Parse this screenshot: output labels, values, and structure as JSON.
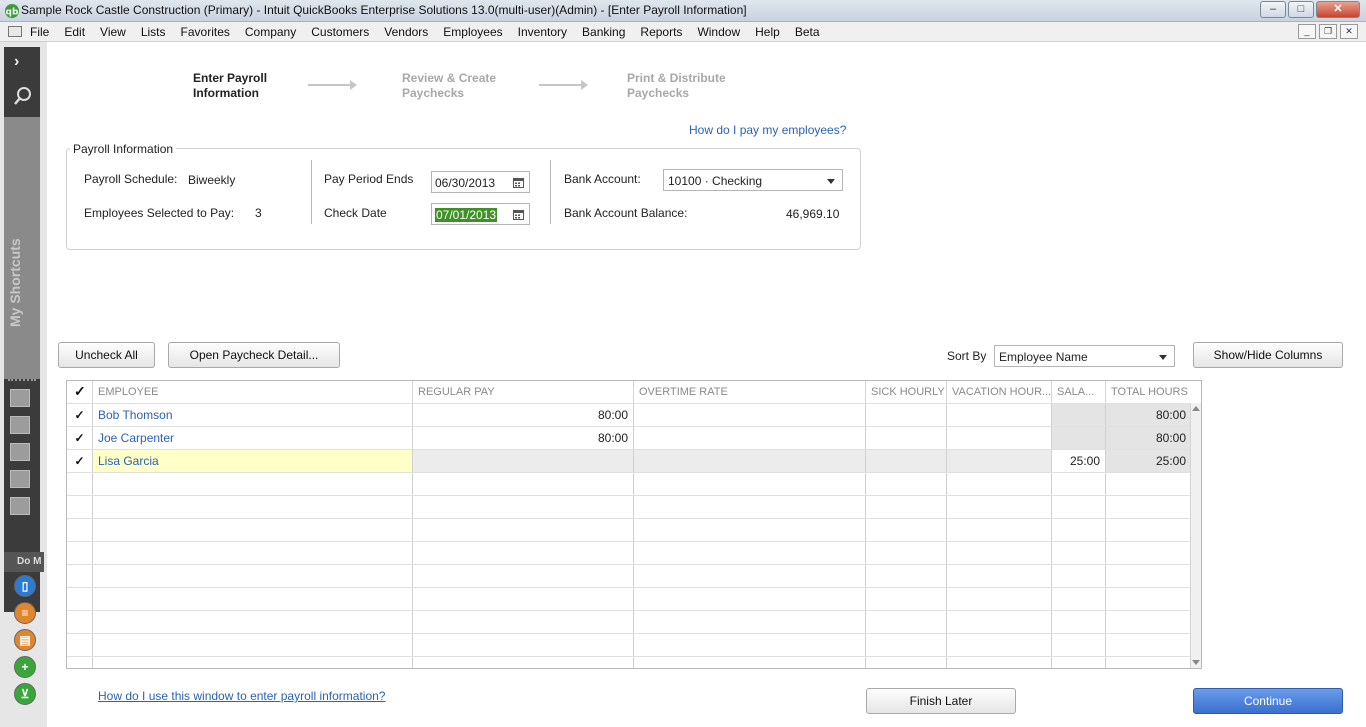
{
  "window": {
    "title": "Sample Rock Castle Construction (Primary)  - Intuit QuickBooks Enterprise Solutions 13.0(multi-user)(Admin) - [Enter Payroll Information]"
  },
  "menu": [
    "File",
    "Edit",
    "View",
    "Lists",
    "Favorites",
    "Company",
    "Customers",
    "Vendors",
    "Employees",
    "Inventory",
    "Banking",
    "Reports",
    "Window",
    "Help",
    "Beta"
  ],
  "sidebar": {
    "shortcuts_label": "My Shortcuts",
    "do_more_label": "Do M"
  },
  "steps": [
    {
      "line1": "Enter Payroll",
      "line2": "Information",
      "active": true
    },
    {
      "line1": "Review & Create",
      "line2": "Paychecks",
      "active": false
    },
    {
      "line1": "Print & Distribute",
      "line2": "Paychecks",
      "active": false
    }
  ],
  "help_top": "How do I pay my employees?",
  "payroll_info": {
    "legend": "Payroll Information",
    "schedule_label": "Payroll Schedule:",
    "schedule_value": "Biweekly",
    "employees_label": "Employees Selected to Pay:",
    "employees_value": "3",
    "period_ends_label": "Pay Period Ends",
    "period_ends_value": "06/30/2013",
    "check_date_label": "Check Date",
    "check_date_value": "07/01/2013",
    "bank_account_label": "Bank Account:",
    "bank_account_value": "10100 · Checking",
    "balance_label": "Bank Account Balance:",
    "balance_value": "46,969.10"
  },
  "toolbar": {
    "uncheck_all": "Uncheck All",
    "open_detail": "Open Paycheck Detail...",
    "sort_by_label": "Sort By",
    "sort_by_value": "Employee Name",
    "show_hide": "Show/Hide Columns"
  },
  "grid": {
    "check_header": "✓",
    "columns": [
      "EMPLOYEE",
      "REGULAR PAY",
      "OVERTIME RATE",
      "SICK HOURLY",
      "VACATION HOUR...",
      "SALA...",
      "TOTAL HOURS"
    ],
    "rows": [
      {
        "check": "✓",
        "employee": "Bob Thomson",
        "regular": "80:00",
        "overtime": "",
        "sick": "",
        "vacation": "",
        "salary": "",
        "total": "80:00"
      },
      {
        "check": "✓",
        "employee": "Joe Carpenter",
        "regular": "80:00",
        "overtime": "",
        "sick": "",
        "vacation": "",
        "salary": "",
        "total": "80:00"
      },
      {
        "check": "✓",
        "employee": "Lisa Garcia",
        "regular": "",
        "overtime": "",
        "sick": "",
        "vacation": "",
        "salary": "25:00",
        "total": "25:00"
      }
    ]
  },
  "help_bottom": "How do I use this window to enter payroll information?",
  "footer": {
    "finish_later": "Finish Later",
    "continue": "Continue"
  }
}
